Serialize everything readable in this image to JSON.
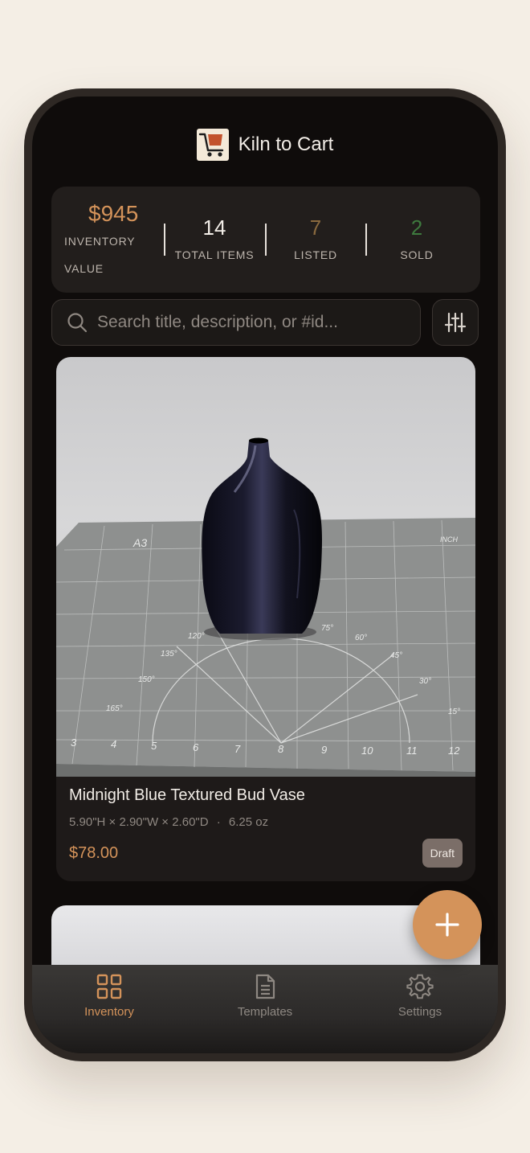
{
  "app": {
    "title": "Kiln to Cart"
  },
  "stats": {
    "inventory_value": {
      "value": "$945",
      "label_line1": "INVENTORY",
      "label_line2": "VALUE"
    },
    "total_items": {
      "value": "14",
      "label": "TOTAL ITEMS"
    },
    "listed": {
      "value": "7",
      "label": "LISTED"
    },
    "sold": {
      "value": "2",
      "label": "SOLD"
    }
  },
  "search": {
    "placeholder": "Search title, description, or #id...",
    "value": ""
  },
  "items": [
    {
      "title": "Midnight Blue Textured Bud Vase",
      "dimensions": "5.90\"H × 2.90\"W × 2.60\"D",
      "separator": "·",
      "weight": "6.25 oz",
      "price": "$78.00",
      "status": "Draft"
    }
  ],
  "mat": {
    "label": "A3",
    "sublabel": "INCH",
    "ruler_numbers": [
      "3",
      "4",
      "5",
      "6",
      "7",
      "8",
      "9",
      "10",
      "11",
      "12"
    ],
    "angles": [
      "120°",
      "135°",
      "150°",
      "165°",
      "75°",
      "60°",
      "45°",
      "30°",
      "15°"
    ]
  },
  "tabs": [
    {
      "label": "Inventory",
      "icon": "grid-icon",
      "active": true
    },
    {
      "label": "Templates",
      "icon": "document-icon",
      "active": false
    },
    {
      "label": "Settings",
      "icon": "gear-icon",
      "active": false
    }
  ],
  "colors": {
    "accent": "#d4935a",
    "background": "#0f0c0b",
    "listed": "#8a6a3f",
    "sold": "#3e7a3e",
    "badge": "#7b6e68"
  }
}
